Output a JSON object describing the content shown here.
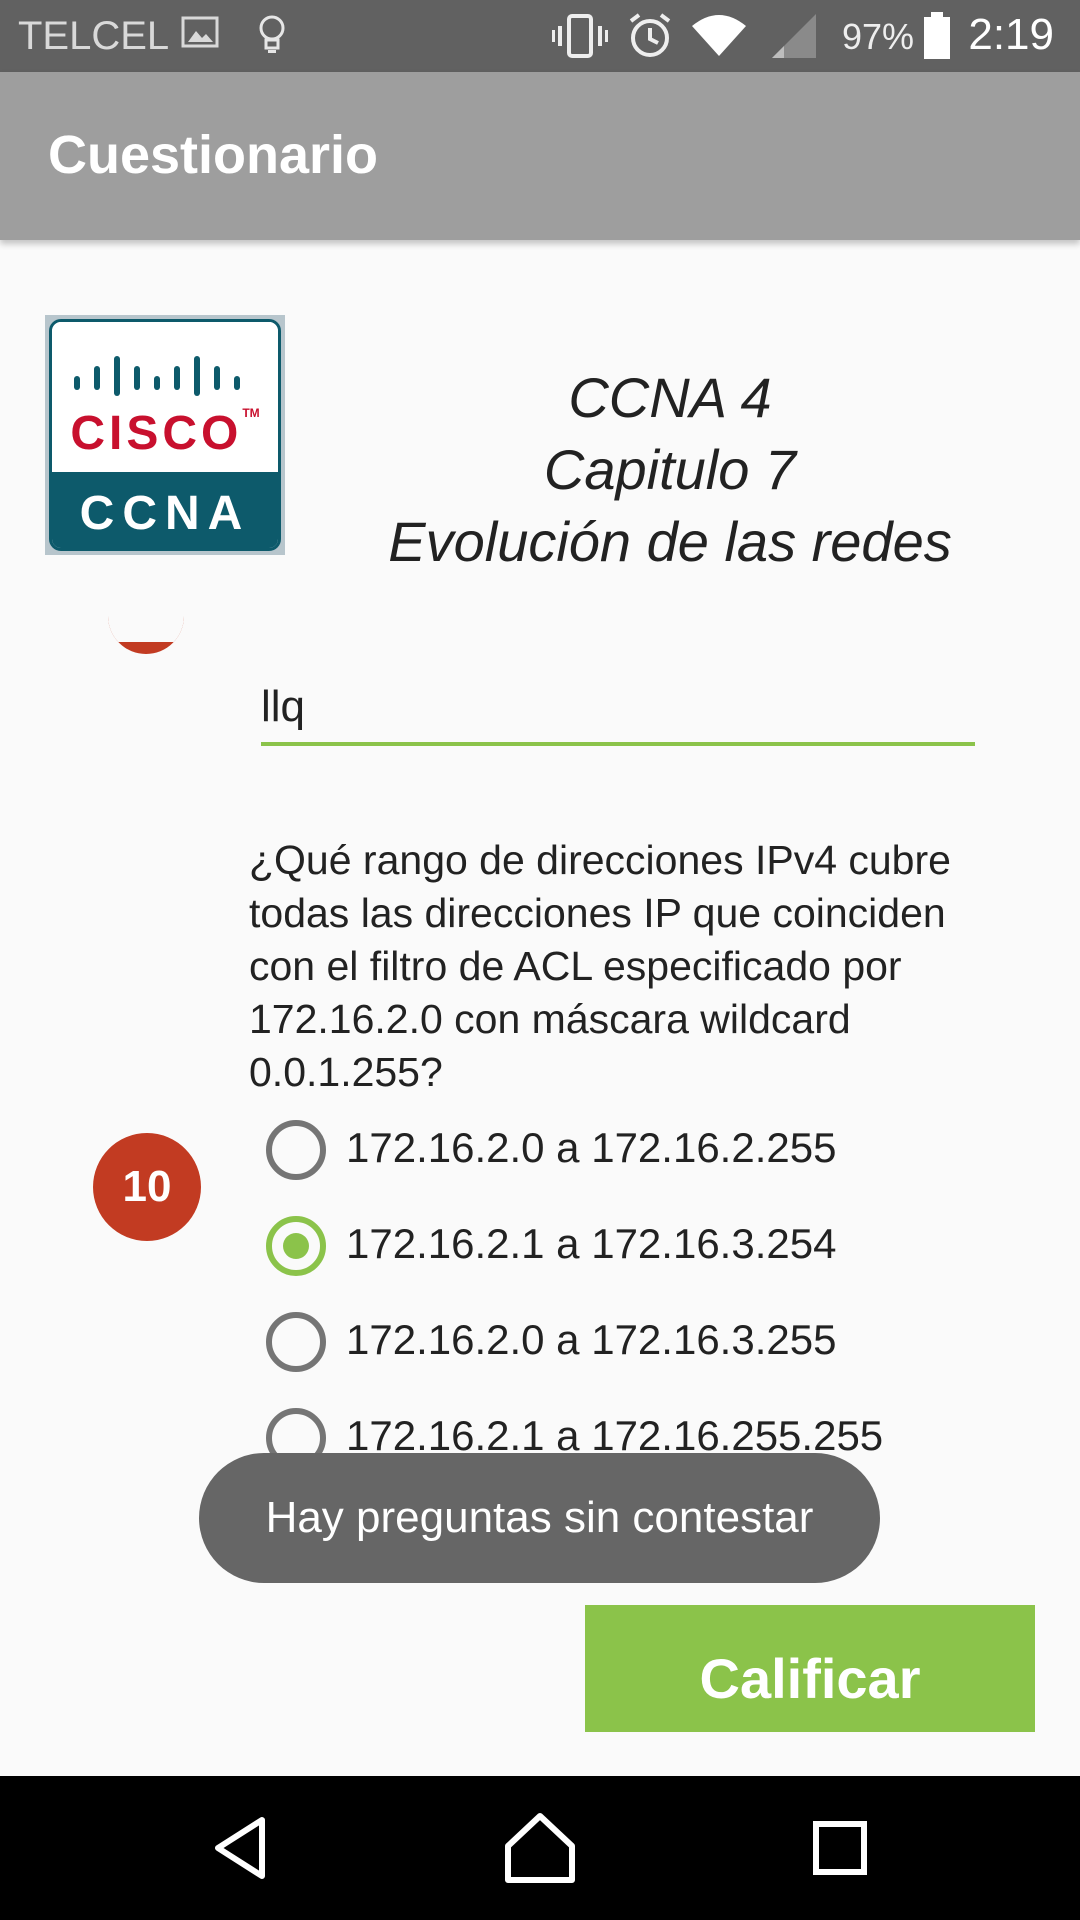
{
  "status_bar": {
    "carrier": "TELCEL",
    "battery_percent": "97%",
    "time": "2:19",
    "icons": [
      "image-icon",
      "lightbulb-icon",
      "vibrate-icon",
      "alarm-icon",
      "wifi-icon",
      "cell-signal-icon",
      "battery-icon"
    ]
  },
  "app_bar": {
    "title": "Cuestionario"
  },
  "header": {
    "logo": {
      "wordmark": "CISCO",
      "trademark": "TM",
      "badge_text": "CCNA",
      "colors": {
        "teal": "#0d5a6b",
        "red": "#c8102e"
      }
    },
    "title_lines": [
      "CCNA 4",
      "Capitulo 7",
      "Evolución de las redes"
    ]
  },
  "previous_item": {
    "answer_value": "llq"
  },
  "question": {
    "number": "10",
    "text": "¿Qué rango de direcciones IPv4 cubre todas las direcciones IP que coinciden con el filtro de ACL especificado por 172.16.2.0 con máscara wildcard 0.0.1.255?",
    "options": [
      {
        "label": "172.16.2.0 a 172.16.2.255",
        "checked": false
      },
      {
        "label": "172.16.2.1 a 172.16.3.254",
        "checked": true
      },
      {
        "label": "172.16.2.0 a 172.16.3.255",
        "checked": false
      },
      {
        "label": "172.16.2.1 a 172.16.255.255",
        "checked": false
      }
    ]
  },
  "toast": {
    "message": "Hay preguntas sin contestar"
  },
  "actions": {
    "grade_label": "Calificar"
  },
  "nav_bar": {
    "icons": [
      "back-icon",
      "home-icon",
      "recents-icon"
    ]
  },
  "colors": {
    "accent_green": "#8bc34a",
    "badge_red": "#c23b22",
    "app_bar_gray": "#9e9e9e",
    "status_bar_gray": "#616161"
  }
}
